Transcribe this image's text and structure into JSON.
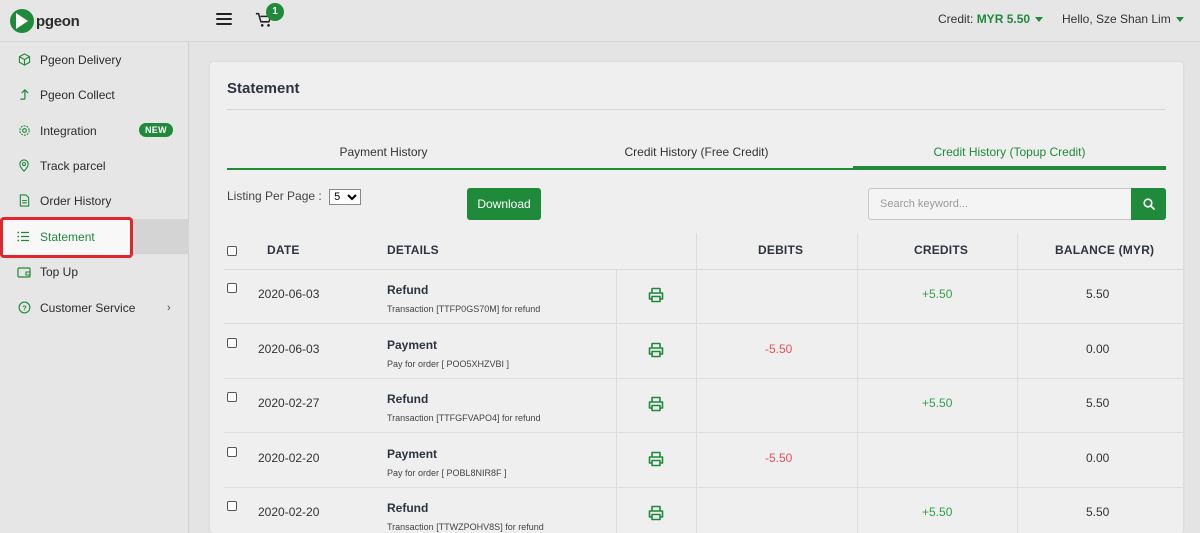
{
  "brand": {
    "name": "pgeon"
  },
  "header": {
    "cart_count": "1",
    "credit_label": "Credit:",
    "credit_value": "MYR 5.50",
    "user_greeting": "Hello, Sze Shan Lim"
  },
  "sidebar": {
    "items": [
      {
        "label": "Pgeon Delivery",
        "icon": "box-icon"
      },
      {
        "label": "Pgeon Collect",
        "icon": "arrow-up-icon"
      },
      {
        "label": "Integration",
        "icon": "gear-icon",
        "badge": "NEW"
      },
      {
        "label": "Track parcel",
        "icon": "location-pin-icon"
      },
      {
        "label": "Order History",
        "icon": "document-icon"
      },
      {
        "label": "Statement",
        "icon": "list-icon",
        "active": true
      },
      {
        "label": "Top Up",
        "icon": "wallet-icon"
      },
      {
        "label": "Customer Service",
        "icon": "help-circle-icon"
      }
    ]
  },
  "main": {
    "title": "Statement",
    "tabs": [
      {
        "label": "Payment History"
      },
      {
        "label": "Credit History (Free Credit)"
      },
      {
        "label": "Credit History (Topup Credit)",
        "active": true
      }
    ],
    "listing_label": "Listing Per Page :",
    "listing_value": "5",
    "download_label": "Download",
    "search_placeholder": "Search keyword..."
  },
  "table": {
    "headers": {
      "date": "DATE",
      "details": "DETAILS",
      "debits": "DEBITS",
      "credits": "CREDITS",
      "balance": "BALANCE (MYR)"
    },
    "rows": [
      {
        "date": "2020-06-03",
        "type": "Refund",
        "desc": "Transaction [TTFP0GS70M] for refund",
        "debit": "",
        "credit": "+5.50",
        "balance": "5.50"
      },
      {
        "date": "2020-06-03",
        "type": "Payment",
        "desc": "Pay for order [ POO5XHZVBI ]",
        "debit": "-5.50",
        "credit": "",
        "balance": "0.00"
      },
      {
        "date": "2020-02-27",
        "type": "Refund",
        "desc": "Transaction [TTFGFVAPO4] for refund",
        "debit": "",
        "credit": "+5.50",
        "balance": "5.50"
      },
      {
        "date": "2020-02-20",
        "type": "Payment",
        "desc": "Pay for order [ POBL8NIR8F ]",
        "debit": "-5.50",
        "credit": "",
        "balance": "0.00"
      },
      {
        "date": "2020-02-20",
        "type": "Refund",
        "desc": "Transaction [TTWZPOHV8S] for refund",
        "debit": "",
        "credit": "+5.50",
        "balance": "5.50"
      }
    ]
  },
  "colors": {
    "accent": "#1f8a3a",
    "debit": "#e0535a",
    "credit": "#2ea24a",
    "highlight": "#e0252c"
  }
}
